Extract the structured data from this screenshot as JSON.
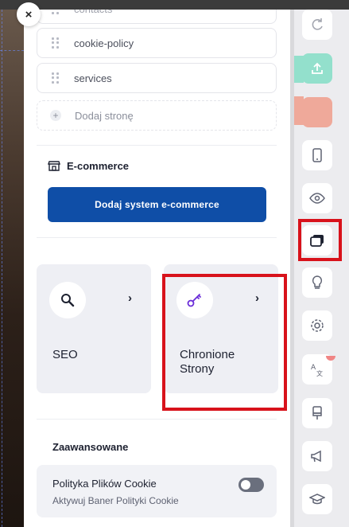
{
  "close_label": "×",
  "pages": {
    "partial_item": "contacts",
    "items": [
      "cookie-policy",
      "services"
    ],
    "add_page_label": "Dodaj stronę"
  },
  "ecommerce": {
    "title": "E-commerce",
    "button_label": "Dodaj system e-commerce"
  },
  "cards": [
    {
      "label": "SEO",
      "icon": "search-icon"
    },
    {
      "label": "Chronione Strony",
      "icon": "key-icon"
    }
  ],
  "advanced": {
    "title": "Zaawansowane",
    "cookie_title": "Polityka Plików Cookie",
    "cookie_subtitle": "Aktywuj Baner Polityki Cookie",
    "cookie_enabled": false
  },
  "toolbar": {
    "icons": [
      "redo-icon",
      "publish-icon",
      "accent-icon",
      "mobile-icon",
      "preview-icon",
      "pages-icon",
      "ideas-icon",
      "settings-icon",
      "translate-icon",
      "brush-icon",
      "marketing-icon",
      "academy-icon"
    ]
  },
  "colors": {
    "primary_button": "#0f4ea7",
    "highlight": "#d8121b",
    "teal": "#93e0cc",
    "salmon": "#efa99a"
  }
}
